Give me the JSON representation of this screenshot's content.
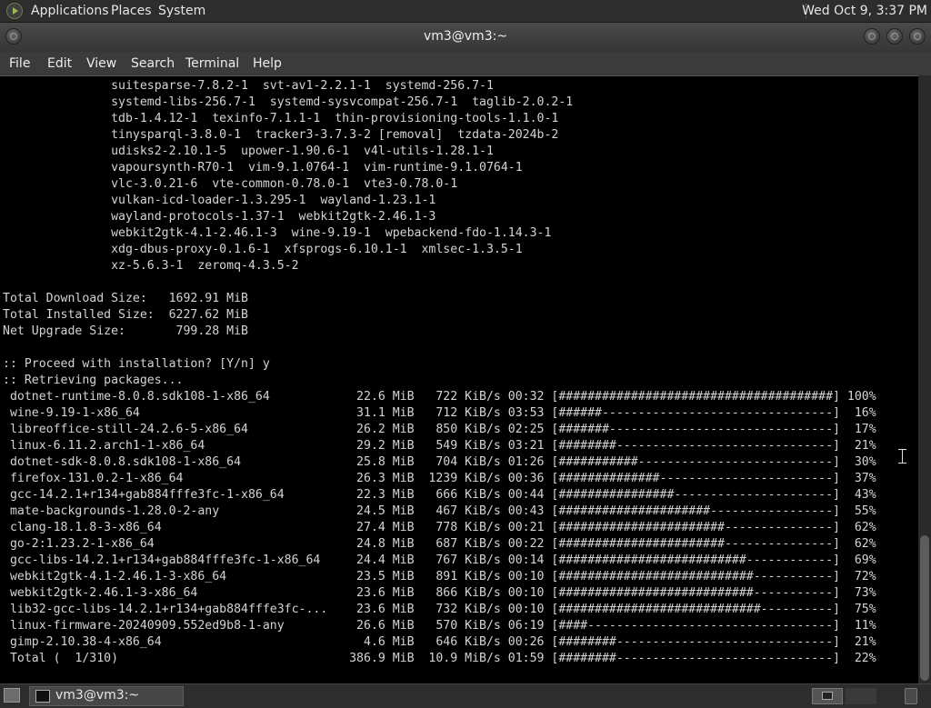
{
  "top_panel": {
    "menus": [
      "Applications",
      "Places",
      "System"
    ],
    "clock": "Wed Oct 9, 3:37 PM"
  },
  "window": {
    "title": "vm3@vm3:~",
    "menubar": [
      "File",
      "Edit",
      "View",
      "Search",
      "Terminal",
      "Help"
    ]
  },
  "terminal": {
    "lines": [
      "               suitesparse-7.8.2-1  svt-av1-2.2.1-1  systemd-256.7-1",
      "               systemd-libs-256.7-1  systemd-sysvcompat-256.7-1  taglib-2.0.2-1",
      "               tdb-1.4.12-1  texinfo-7.1.1-1  thin-provisioning-tools-1.1.0-1",
      "               tinysparql-3.8.0-1  tracker3-3.7.3-2 [removal]  tzdata-2024b-2",
      "               udisks2-2.10.1-5  upower-1.90.6-1  v4l-utils-1.28.1-1",
      "               vapoursynth-R70-1  vim-9.1.0764-1  vim-runtime-9.1.0764-1",
      "               vlc-3.0.21-6  vte-common-0.78.0-1  vte3-0.78.0-1",
      "               vulkan-icd-loader-1.3.295-1  wayland-1.23.1-1",
      "               wayland-protocols-1.37-1  webkit2gtk-2.46.1-3",
      "               webkit2gtk-4.1-2.46.1-3  wine-9.19-1  wpebackend-fdo-1.14.3-1",
      "               xdg-dbus-proxy-0.1.6-1  xfsprogs-6.10.1-1  xmlsec-1.3.5-1",
      "               xz-5.6.3-1  zeromq-4.3.5-2",
      "",
      "Total Download Size:   1692.91 MiB",
      "Total Installed Size:  6227.62 MiB",
      "Net Upgrade Size:       799.28 MiB",
      "",
      ":: Proceed with installation? [Y/n] y",
      ":: Retrieving packages...",
      " dotnet-runtime-8.0.8.sdk108-1-x86_64            22.6 MiB   722 KiB/s 00:32 [######################################] 100%",
      " wine-9.19-1-x86_64                              31.1 MiB   712 KiB/s 03:53 [######--------------------------------]  16%",
      " libreoffice-still-24.2.6-5-x86_64               26.2 MiB   850 KiB/s 02:25 [#######-------------------------------]  17%",
      " linux-6.11.2.arch1-1-x86_64                     29.2 MiB   549 KiB/s 03:21 [########------------------------------]  21%",
      " dotnet-sdk-8.0.8.sdk108-1-x86_64                25.8 MiB   704 KiB/s 01:26 [###########---------------------------]  30%",
      " firefox-131.0.2-1-x86_64                        26.3 MiB  1239 KiB/s 00:36 [##############------------------------]  37%",
      " gcc-14.2.1+r134+gab884fffe3fc-1-x86_64          22.3 MiB   666 KiB/s 00:44 [################----------------------]  43%",
      " mate-backgrounds-1.28.0-2-any                   24.5 MiB   467 KiB/s 00:43 [#####################-----------------]  55%",
      " clang-18.1.8-3-x86_64                           27.4 MiB   778 KiB/s 00:21 [#######################---------------]  62%",
      " go-2:1.23.2-1-x86_64                            24.8 MiB   687 KiB/s 00:22 [#######################---------------]  62%",
      " gcc-libs-14.2.1+r134+gab884fffe3fc-1-x86_64     24.4 MiB   767 KiB/s 00:14 [##########################------------]  69%",
      " webkit2gtk-4.1-2.46.1-3-x86_64                  23.5 MiB   891 KiB/s 00:10 [###########################-----------]  72%",
      " webkit2gtk-2.46.1-3-x86_64                      23.6 MiB   866 KiB/s 00:10 [###########################-----------]  73%",
      " lib32-gcc-libs-14.2.1+r134+gab884fffe3fc-...    23.6 MiB   732 KiB/s 00:10 [############################----------]  75%",
      " linux-firmware-20240909.552ed9b8-1-any          26.6 MiB   570 KiB/s 06:19 [####----------------------------------]  11%",
      " gimp-2.10.38-4-x86_64                            4.6 MiB   646 KiB/s 00:26 [########------------------------------]  21%",
      " Total (  1/310)                                386.9 MiB  10.9 MiB/s 01:59 [########------------------------------]  22%"
    ]
  },
  "taskbar": {
    "task_label": "vm3@vm3:~"
  },
  "icons": {
    "app_menu": "foot-logo-icon",
    "show_desktop": "show-desktop-icon",
    "terminal_task": "terminal-icon",
    "workspace": "workspace-switcher-icon",
    "trash": "trash-icon"
  }
}
